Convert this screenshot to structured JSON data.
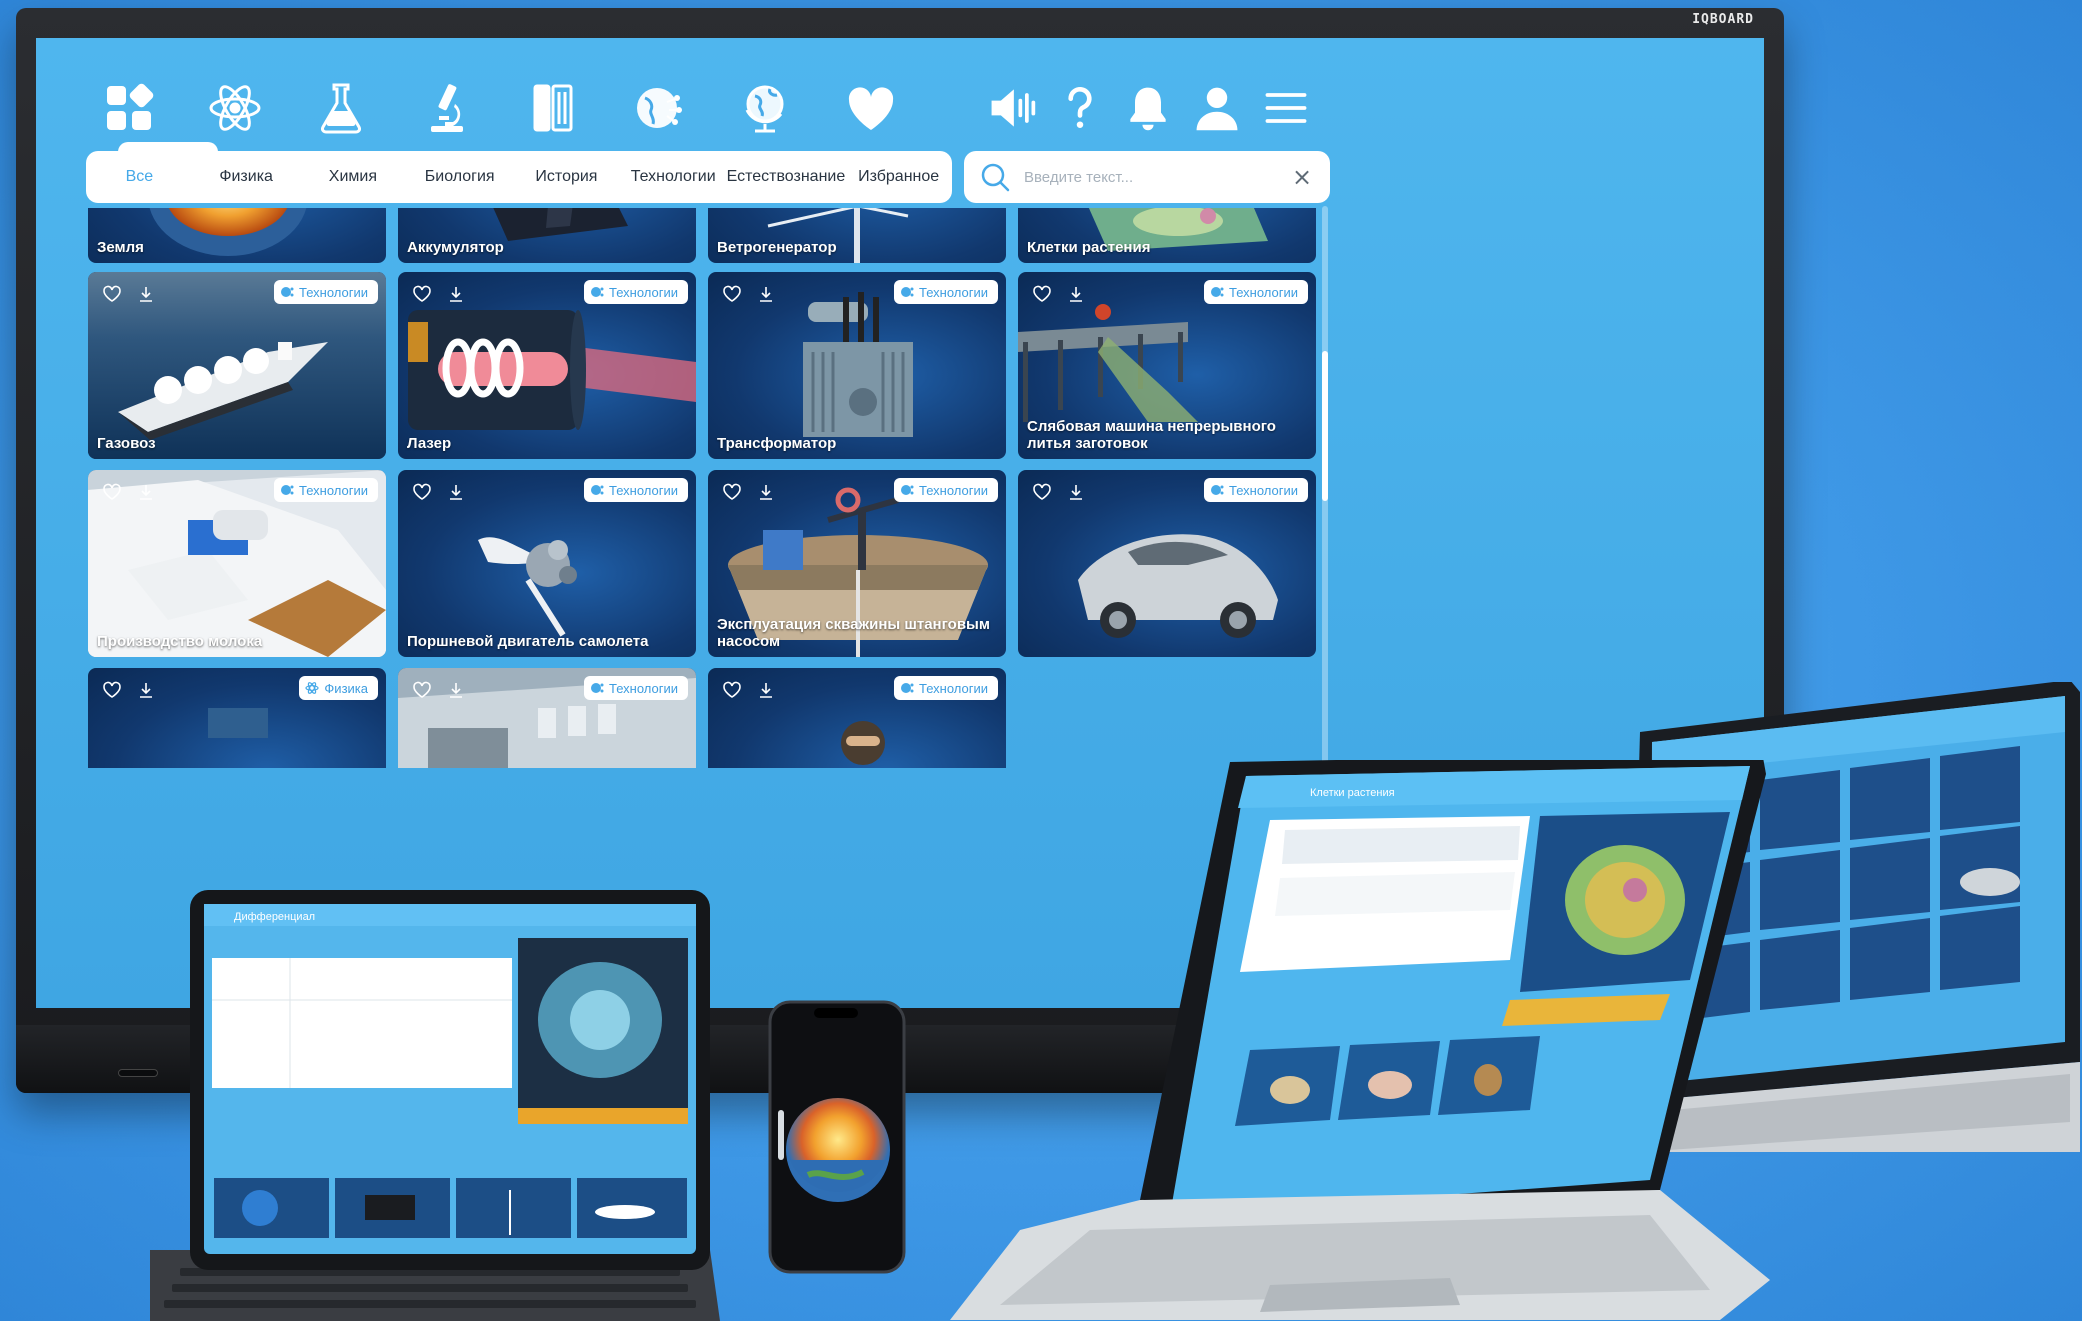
{
  "nav": {
    "tabs": [
      {
        "label": "Все",
        "active": true
      },
      {
        "label": "Физика",
        "active": false
      },
      {
        "label": "Химия",
        "active": false
      },
      {
        "label": "Биология",
        "active": false
      },
      {
        "label": "История",
        "active": false
      },
      {
        "label": "Технологии",
        "active": false
      },
      {
        "label": "Естествознание",
        "active": false
      },
      {
        "label": "Избранное",
        "active": false
      }
    ],
    "category_icons": [
      "grid-icon",
      "atom-icon",
      "flask-icon",
      "microscope-icon",
      "book-icon",
      "globe-network-icon",
      "globe-icon",
      "heart-icon"
    ],
    "tool_icons": [
      "speaker-icon",
      "help-icon",
      "bell-icon",
      "user-icon",
      "menu-icon"
    ]
  },
  "search": {
    "placeholder": "Введите текст...",
    "value": ""
  },
  "cards": [
    {
      "title": "Земля",
      "tag": ""
    },
    {
      "title": "Аккумулятор",
      "tag": ""
    },
    {
      "title": "Ветрогенератор",
      "tag": ""
    },
    {
      "title": "Клетки растения",
      "tag": ""
    },
    {
      "title": "Газовоз",
      "tag": "Технологии"
    },
    {
      "title": "Лазер",
      "tag": "Технологии"
    },
    {
      "title": "Трансформатор",
      "tag": "Технологии"
    },
    {
      "title": "Слябовая машина непрерывного литья заготовок",
      "tag": "Технологии"
    },
    {
      "title": "Производство молока",
      "tag": "Технологии"
    },
    {
      "title": "Поршневой двигатель самолета",
      "tag": "Технологии"
    },
    {
      "title": "Эксплуатация скважины штанговым насосом",
      "tag": "Технологии"
    },
    {
      "title": "",
      "tag": "Технологии"
    },
    {
      "title": "",
      "tag": "Физика"
    },
    {
      "title": "",
      "tag": "Технологии"
    },
    {
      "title": "",
      "tag": "Технологии"
    }
  ],
  "monitor": {
    "brand": "IQBOARD"
  },
  "devices": {
    "tablet_title": "Дифференциал",
    "laptop_title": "Клетки растения"
  },
  "colors": {
    "accent": "#46a9e8",
    "screen_bg": "#4fb6ee",
    "card_bg": "#11386e",
    "page_bg": "#3e98e6"
  }
}
